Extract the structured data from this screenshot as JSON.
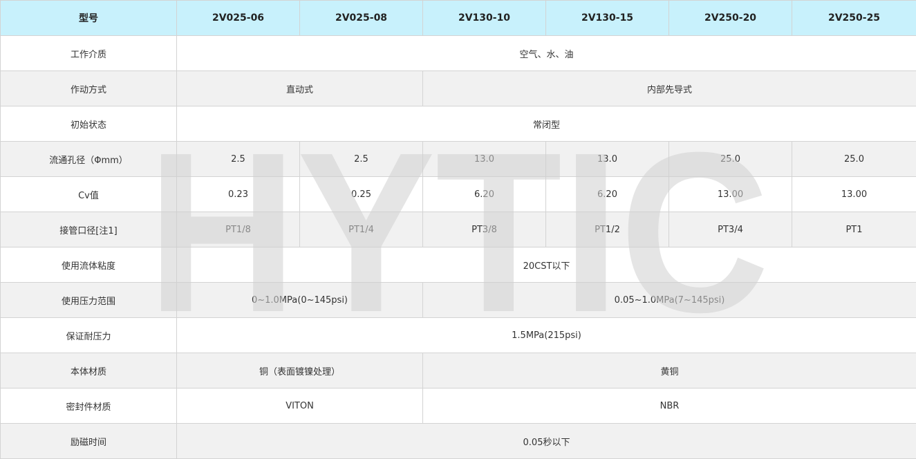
{
  "header": {
    "label": "型号",
    "models": [
      "2V025-06",
      "2V025-08",
      "2V130-10",
      "2V130-15",
      "2V250-20",
      "2V250-25"
    ]
  },
  "rows": {
    "medium": {
      "label": "工作介质",
      "value": "空气、水、油"
    },
    "operation": {
      "label": "作动方式",
      "direct": "直动式",
      "pilot": "内部先导式"
    },
    "initial_state": {
      "label": "初始状态",
      "value": "常闭型"
    },
    "orifice": {
      "label": "流通孔径（Φmm）",
      "values": [
        "2.5",
        "2.5",
        "13.0",
        "13.0",
        "25.0",
        "25.0"
      ]
    },
    "cv": {
      "label": "Cv值",
      "values": [
        "0.23",
        "0.25",
        "6.20",
        "6.20",
        "13.00",
        "13.00"
      ]
    },
    "port": {
      "label": "接管口径[注1]",
      "values": [
        "PT1/8",
        "PT1/4",
        "PT3/8",
        "PT1/2",
        "PT3/4",
        "PT1"
      ]
    },
    "viscosity": {
      "label": "使用流体粘度",
      "value": "20CST以下"
    },
    "pressure": {
      "label": "使用压力范围",
      "small": "0~1.0MPa(0~145psi)",
      "large": "0.05~1.0MPa(7~145psi)"
    },
    "proof": {
      "label": "保证耐压力",
      "value": "1.5MPa(215psi)"
    },
    "body_material": {
      "label": "本体材质",
      "small": "铜（表面镀镍处理）",
      "large": "黄铜"
    },
    "seal_material": {
      "label": "密封件材质",
      "small": "VITON",
      "large": "NBR"
    },
    "response": {
      "label": "励磁时间",
      "value": "0.05秒以下"
    }
  },
  "watermark": {
    "text": "HYTIC",
    "color": "#cfcfcf"
  },
  "colors": {
    "header_bg": "#c8f1fc",
    "alt_row_bg": "#f1f1f1",
    "border": "#d3d3d3"
  }
}
